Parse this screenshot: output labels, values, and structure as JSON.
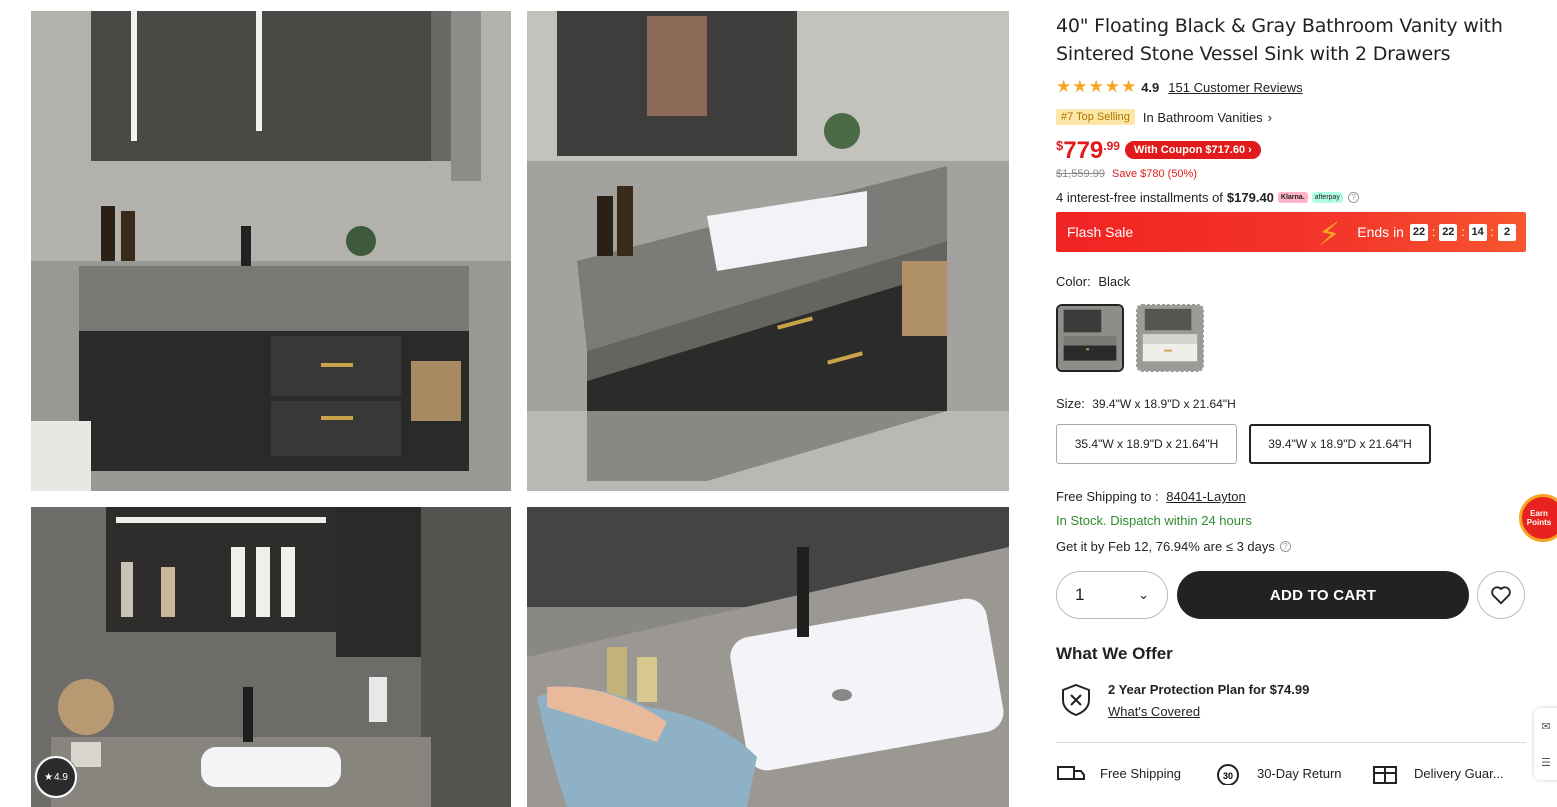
{
  "gallery": {
    "rating_badge": "4.9",
    "images": [
      {
        "name": "vanity-front-view"
      },
      {
        "name": "vanity-angle-view"
      },
      {
        "name": "vanity-mirror-cabinet-open"
      },
      {
        "name": "vanity-sink-cleaning"
      }
    ]
  },
  "product": {
    "title": "40\" Floating Black & Gray Bathroom Vanity with Sintered Stone Vessel Sink with 2 Drawers",
    "stars": "★★★★★",
    "rating": "4.9",
    "reviews": "151 Customer Reviews",
    "rank_badge": "#7 Top Selling",
    "rank_category": "In Bathroom Vanities",
    "price_currency": "$",
    "price_whole": "779",
    "price_cents": ".99",
    "coupon": "With Coupon $717.60",
    "was_price": "$1,559.99",
    "save": "Save $780 (50%)",
    "installments_text": "4 interest-free installments of",
    "installments_amount": "$179.40",
    "klarna": "Klarna.",
    "afterpay": "afterpay",
    "flash": {
      "label": "Flash Sale",
      "ends_in": "Ends in",
      "timer": [
        "22",
        "22",
        "14",
        "2"
      ]
    },
    "color": {
      "label": "Color:",
      "value": "Black",
      "options": [
        "Black",
        "White"
      ]
    },
    "size": {
      "label": "Size:",
      "value": "39.4\"W x 18.9\"D x 21.64\"H",
      "options": [
        "35.4\"W x 18.9\"D x 21.64\"H",
        "39.4\"W x 18.9\"D x 21.64\"H"
      ]
    },
    "shipping": {
      "label": "Free Shipping to :",
      "location": "84041-Layton",
      "stock": "In Stock. Dispatch within 24 hours",
      "eta": "Get it by Feb 12, 76.94% are ≤ 3 days"
    },
    "quantity": "1",
    "add_to_cart": "ADD TO CART",
    "offer": {
      "title": "What We Offer",
      "plan": "2 Year Protection Plan for $74.99",
      "link": "What's Covered"
    },
    "perks": [
      "Free Shipping",
      "30-Day Return",
      "Delivery Guar..."
    ]
  },
  "floating": {
    "earn_points": "Earn Points"
  },
  "colors": {
    "accent": "#e11b1b",
    "stars": "#f6a623",
    "stock": "#2e8b2e",
    "button": "#222222"
  }
}
